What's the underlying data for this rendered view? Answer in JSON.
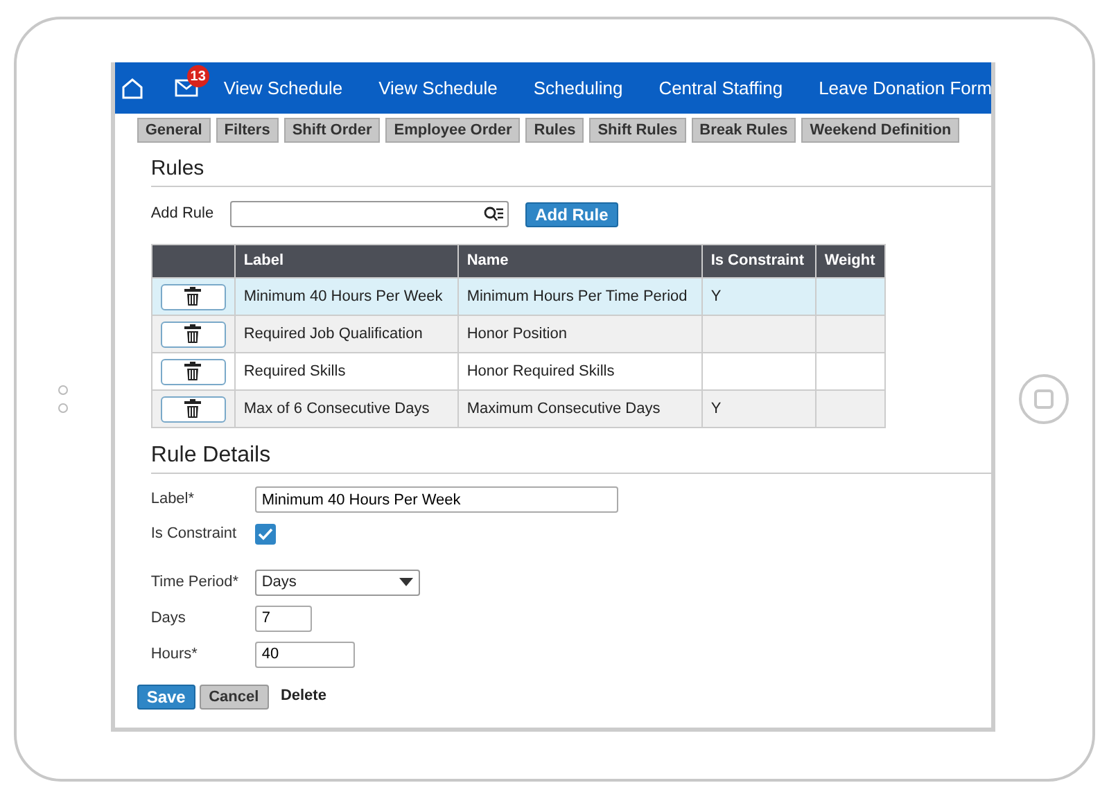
{
  "nav": {
    "badge": "13",
    "items": [
      "View Schedule",
      "View Schedule",
      "Scheduling",
      "Central Staffing",
      "Leave Donation Form"
    ]
  },
  "tabs": [
    "General",
    "Filters",
    "Shift Order",
    "Employee Order",
    "Rules",
    "Shift Rules",
    "Break Rules",
    "Weekend Definition"
  ],
  "rules": {
    "title": "Rules",
    "add_label": "Add Rule",
    "add_button": "Add Rule",
    "columns": [
      "Label",
      "Name",
      "Is Constraint",
      "Weight"
    ],
    "rows": [
      {
        "label": "Minimum 40 Hours Per Week",
        "name": "Minimum Hours Per Time Period",
        "is_constraint": "Y",
        "selected": true
      },
      {
        "label": "Required Job Qualification",
        "name": "Honor Position",
        "is_constraint": "",
        "selected": false
      },
      {
        "label": "Required Skills",
        "name": "Honor Required Skills",
        "is_constraint": "",
        "selected": false
      },
      {
        "label": "Max of 6 Consecutive Days",
        "name": "Maximum Consecutive Days",
        "is_constraint": "Y",
        "selected": false
      }
    ]
  },
  "details": {
    "title": "Rule Details",
    "label_field": {
      "label": "Label*",
      "value": "Minimum 40 Hours Per Week"
    },
    "constraint": {
      "label": "Is Constraint",
      "checked": true
    },
    "time_period": {
      "label": "Time Period*",
      "value": "Days"
    },
    "days": {
      "label": "Days",
      "value": "7"
    },
    "hours": {
      "label": "Hours*",
      "value": "40"
    },
    "buttons": {
      "save": "Save",
      "cancel": "Cancel",
      "delete": "Delete"
    }
  }
}
